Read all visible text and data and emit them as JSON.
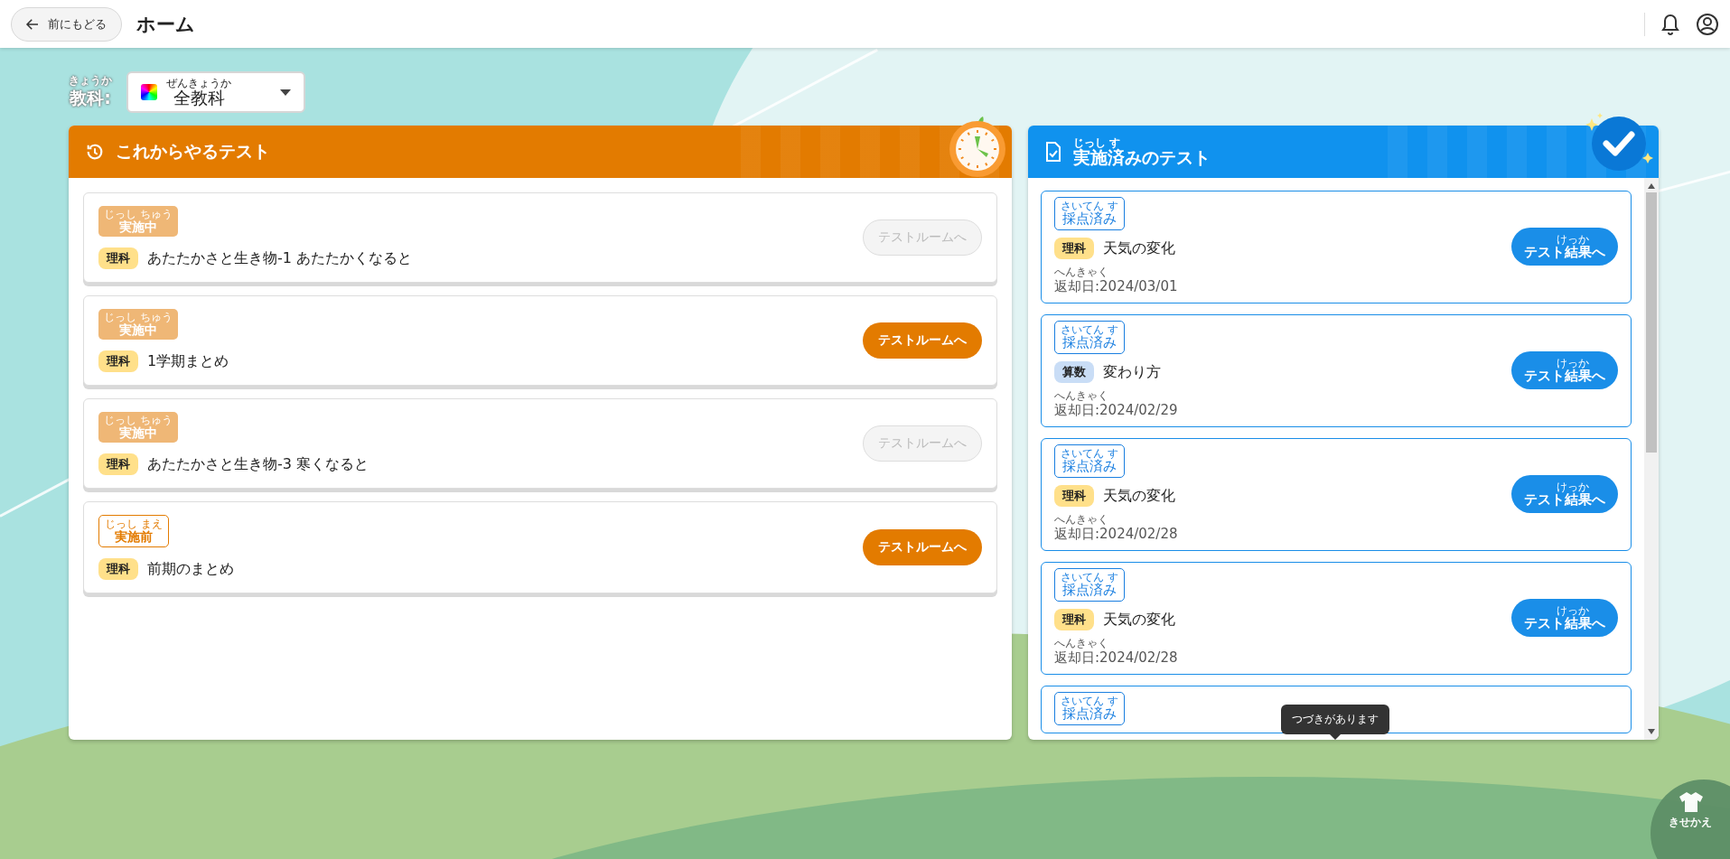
{
  "header": {
    "back_button": "前にもどる",
    "title": "ホーム"
  },
  "subject_filter": {
    "label": "教科:",
    "label_ruby": "きょうか",
    "value": "全教科",
    "value_ruby": "ぜんきょうか"
  },
  "upcoming": {
    "title": "これからやるテスト",
    "tests": [
      {
        "status": {
          "kind": "in_progress",
          "label": "実施中",
          "ruby": "じっし ちゅう"
        },
        "subject": {
          "label": "理科",
          "color": "#ffe08a"
        },
        "name": "あたたかさと生き物-1 あたたかくなると",
        "button": {
          "label": "テストルームへ",
          "disabled": true
        }
      },
      {
        "status": {
          "kind": "in_progress",
          "label": "実施中",
          "ruby": "じっし ちゅう"
        },
        "subject": {
          "label": "理科",
          "color": "#ffe08a"
        },
        "name": "1学期まとめ",
        "button": {
          "label": "テストルームへ",
          "disabled": false
        }
      },
      {
        "status": {
          "kind": "in_progress",
          "label": "実施中",
          "ruby": "じっし ちゅう"
        },
        "subject": {
          "label": "理科",
          "color": "#ffe08a"
        },
        "name": "あたたかさと生き物-3 寒くなると",
        "button": {
          "label": "テストルームへ",
          "disabled": true
        }
      },
      {
        "status": {
          "kind": "not_started",
          "label": "実施前",
          "ruby": "じっし まえ"
        },
        "subject": {
          "label": "理科",
          "color": "#ffe08a"
        },
        "name": "前期のまとめ",
        "button": {
          "label": "テストルームへ",
          "disabled": false
        }
      }
    ]
  },
  "completed": {
    "title": "実施済みのテスト",
    "title_ruby": "じっし す",
    "tests": [
      {
        "status": {
          "label": "採点済み",
          "ruby": "さいてん す"
        },
        "subject": {
          "label": "理科",
          "color": "#ffe08a"
        },
        "name": "天気の変化",
        "return_date": {
          "label": "返却日:2024/03/01",
          "ruby": "へんきゃく"
        },
        "button": {
          "label": "テスト結果へ",
          "ruby": "けっか"
        }
      },
      {
        "status": {
          "label": "採点済み",
          "ruby": "さいてん す"
        },
        "subject": {
          "label": "算数",
          "color": "#c9ddf6"
        },
        "name": "変わり方",
        "return_date": {
          "label": "返却日:2024/02/29",
          "ruby": "へんきゃく"
        },
        "button": {
          "label": "テスト結果へ",
          "ruby": "けっか"
        }
      },
      {
        "status": {
          "label": "採点済み",
          "ruby": "さいてん す"
        },
        "subject": {
          "label": "理科",
          "color": "#ffe08a"
        },
        "name": "天気の変化",
        "return_date": {
          "label": "返却日:2024/02/28",
          "ruby": "へんきゃく"
        },
        "button": {
          "label": "テスト結果へ",
          "ruby": "けっか"
        }
      },
      {
        "status": {
          "label": "採点済み",
          "ruby": "さいてん す"
        },
        "subject": {
          "label": "理科",
          "color": "#ffe08a"
        },
        "name": "天気の変化",
        "return_date": {
          "label": "返却日:2024/02/28",
          "ruby": "へんきゃく"
        },
        "button": {
          "label": "テスト結果へ",
          "ruby": "けっか"
        }
      },
      {
        "status": {
          "label": "採点済み",
          "ruby": "さいてん す"
        }
      }
    ],
    "more_tooltip": "つづきがあります"
  },
  "dress_up_button": "きせかえ"
}
